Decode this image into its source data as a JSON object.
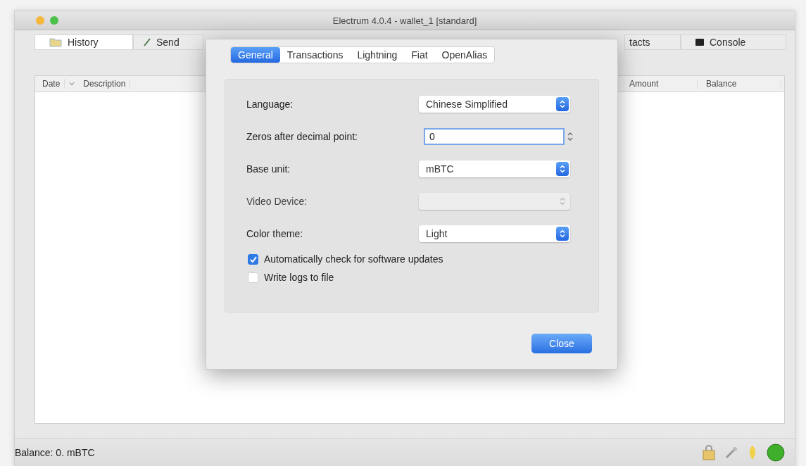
{
  "window": {
    "title": "Electrum 4.0.4  -  wallet_1  [standard]"
  },
  "main_tabs": [
    {
      "label": "History",
      "kind": "history",
      "selected": true
    },
    {
      "label": "Send",
      "kind": "send",
      "selected": false
    },
    {
      "label": "tacts",
      "kind": "contacts",
      "selected": false
    },
    {
      "label": "Console",
      "kind": "console",
      "selected": false
    }
  ],
  "table": {
    "columns": [
      "Date",
      "Description",
      "Amount",
      "Balance"
    ]
  },
  "dialog": {
    "tabs": [
      {
        "label": "General",
        "selected": true
      },
      {
        "label": "Transactions",
        "selected": false
      },
      {
        "label": "Lightning",
        "selected": false
      },
      {
        "label": "Fiat",
        "selected": false
      },
      {
        "label": "OpenAlias",
        "selected": false
      }
    ],
    "fields": [
      {
        "label": "Language:",
        "kind": "select",
        "value": "Chinese Simplified",
        "disabled": false
      },
      {
        "label": "Zeros after decimal point:",
        "kind": "spin",
        "value": "0",
        "disabled": false
      },
      {
        "label": "Base unit:",
        "kind": "select",
        "value": "mBTC",
        "disabled": false
      },
      {
        "label": "Video Device:",
        "kind": "select",
        "disabled": true
      },
      {
        "label": "Color theme:",
        "kind": "select",
        "value": "Light",
        "disabled": false
      }
    ],
    "checkboxes": [
      {
        "label": "Automatically check for software updates",
        "checked": true
      },
      {
        "label": "Write logs to file",
        "checked": false
      }
    ],
    "button": "Close"
  },
  "status_bar": {
    "balance": "Balance: 0. mBTC"
  }
}
